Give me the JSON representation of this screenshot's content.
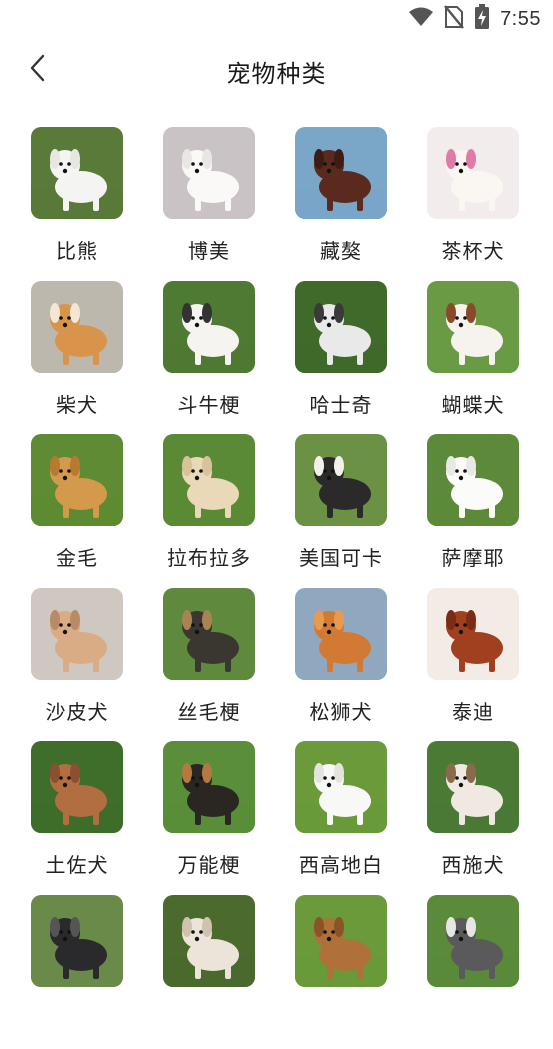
{
  "status_bar": {
    "time": "7:55",
    "icons": [
      "wifi-icon",
      "no-sim-icon",
      "battery-charging-icon"
    ]
  },
  "header": {
    "title": "宠物种类",
    "back_icon": "chevron-left-icon"
  },
  "breeds": [
    {
      "name": "比熊",
      "bg": "#5a7a3a",
      "dog": "#f4f4f2",
      "accent": "#e8e6e0"
    },
    {
      "name": "博美",
      "bg": "#c9c3c6",
      "dog": "#faf9f7",
      "accent": "#e9e7e4"
    },
    {
      "name": "藏獒",
      "bg": "#7aa6c8",
      "dog": "#5a2a1e",
      "accent": "#3e1c14"
    },
    {
      "name": "茶杯犬",
      "bg": "#f3ecec",
      "dog": "#faf7f2",
      "accent": "#e07aa8"
    },
    {
      "name": "柴犬",
      "bg": "#bdb8ad",
      "dog": "#d8944a",
      "accent": "#f3e6d4"
    },
    {
      "name": "斗牛梗",
      "bg": "#4f7a33",
      "dog": "#f5f4f0",
      "accent": "#333333"
    },
    {
      "name": "哈士奇",
      "bg": "#3f6a2a",
      "dog": "#e9e9e9",
      "accent": "#3a3a3a"
    },
    {
      "name": "蝴蝶犬",
      "bg": "#6a9a44",
      "dog": "#f6f3ee",
      "accent": "#8a4a2a"
    },
    {
      "name": "金毛",
      "bg": "#5e8b33",
      "dog": "#d29a4a",
      "accent": "#b77a30"
    },
    {
      "name": "拉布拉多",
      "bg": "#5b8a36",
      "dog": "#ead9b8",
      "accent": "#d8c29a"
    },
    {
      "name": "美国可卡",
      "bg": "#6b9244",
      "dog": "#2a2a2a",
      "accent": "#f2f0ea"
    },
    {
      "name": "萨摩耶",
      "bg": "#5d8a3a",
      "dog": "#fbfbf9",
      "accent": "#e9e8e4"
    },
    {
      "name": "沙皮犬",
      "bg": "#cfc8c0",
      "dog": "#d9ac86",
      "accent": "#b98a66"
    },
    {
      "name": "丝毛梗",
      "bg": "#5f8a3e",
      "dog": "#3a3630",
      "accent": "#a88452"
    },
    {
      "name": "松狮犬",
      "bg": "#8fa8c0",
      "dog": "#d27a34",
      "accent": "#e89a50"
    },
    {
      "name": "泰迪",
      "bg": "#f2ebe6",
      "dog": "#a0401e",
      "accent": "#7a2c14"
    },
    {
      "name": "土佐犬",
      "bg": "#3f6e2a",
      "dog": "#b26e40",
      "accent": "#8a5030"
    },
    {
      "name": "万能梗",
      "bg": "#5a8e3a",
      "dog": "#2a2622",
      "accent": "#b37a40"
    },
    {
      "name": "西高地白",
      "bg": "#6a9a3a",
      "dog": "#f8f8f6",
      "accent": "#e4e3df"
    },
    {
      "name": "西施犬",
      "bg": "#4a7a34",
      "dog": "#efe9e2",
      "accent": "#8a6a4a"
    },
    {
      "name": "",
      "bg": "#6a8a4a",
      "dog": "#2a2a2c",
      "accent": "#555555"
    },
    {
      "name": "",
      "bg": "#4a6a2e",
      "dog": "#ece4d8",
      "accent": "#cfc2ae"
    },
    {
      "name": "",
      "bg": "#6a9a3a",
      "dog": "#b0703a",
      "accent": "#8a5424"
    },
    {
      "name": "",
      "bg": "#5a8a3a",
      "dog": "#5a5a5c",
      "accent": "#e6e6e6"
    }
  ]
}
